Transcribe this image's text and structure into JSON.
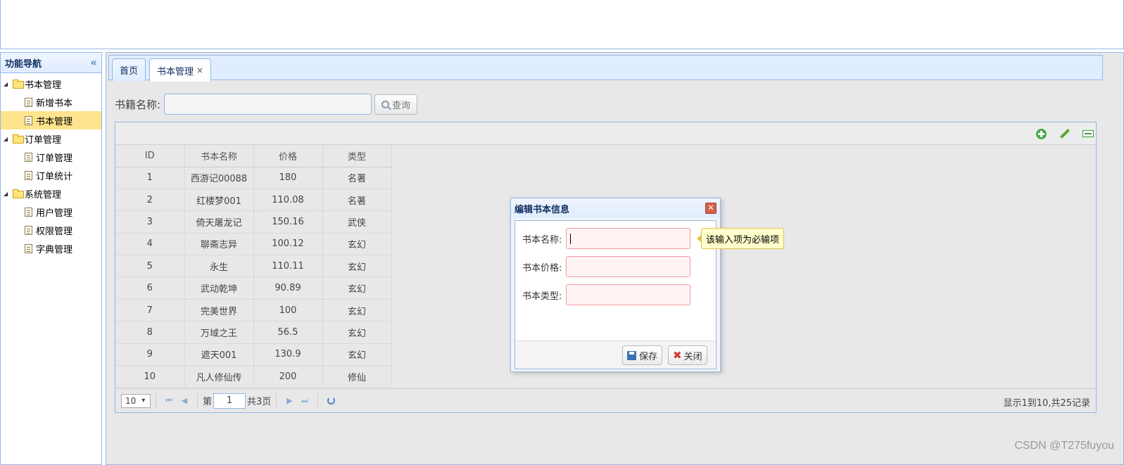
{
  "sidebar": {
    "title": "功能导航",
    "groups": [
      {
        "label": "书本管理",
        "items": [
          "新增书本",
          "书本管理"
        ]
      },
      {
        "label": "订单管理",
        "items": [
          "订单管理",
          "订单统计"
        ]
      },
      {
        "label": "系统管理",
        "items": [
          "用户管理",
          "权限管理",
          "字典管理"
        ]
      }
    ]
  },
  "tabs": [
    {
      "label": "首页"
    },
    {
      "label": "书本管理",
      "close": "×"
    }
  ],
  "search": {
    "label": "书籍名称:",
    "value": "",
    "button": "查询"
  },
  "grid": {
    "columns": [
      "ID",
      "书本名称",
      "价格",
      "类型"
    ],
    "rows": [
      [
        "1",
        "西游记00088",
        "180",
        "名著"
      ],
      [
        "2",
        "红楼梦001",
        "110.08",
        "名著"
      ],
      [
        "3",
        "倚天屠龙记",
        "150.16",
        "武侠"
      ],
      [
        "4",
        "聊斋志异",
        "100.12",
        "玄幻"
      ],
      [
        "5",
        "永生",
        "110.11",
        "玄幻"
      ],
      [
        "6",
        "武动乾坤",
        "90.89",
        "玄幻"
      ],
      [
        "7",
        "完美世界",
        "100",
        "玄幻"
      ],
      [
        "8",
        "万域之王",
        "56.5",
        "玄幻"
      ],
      [
        "9",
        "遮天001",
        "130.9",
        "玄幻"
      ],
      [
        "10",
        "凡人修仙传",
        "200",
        "修仙"
      ]
    ]
  },
  "pager": {
    "page_size": "10",
    "page_prefix": "第",
    "page_number": "1",
    "page_suffix": "共3页",
    "info": "显示1到10,共25记录"
  },
  "dialog": {
    "title": "编辑书本信息",
    "fields": [
      {
        "label": "书本名称:",
        "value": ""
      },
      {
        "label": "书本价格:",
        "value": ""
      },
      {
        "label": "书本类型:",
        "value": ""
      }
    ],
    "save": "保存",
    "close": "关闭",
    "tooltip": "该输入项为必输项"
  },
  "watermark": "CSDN @T275fuyou"
}
